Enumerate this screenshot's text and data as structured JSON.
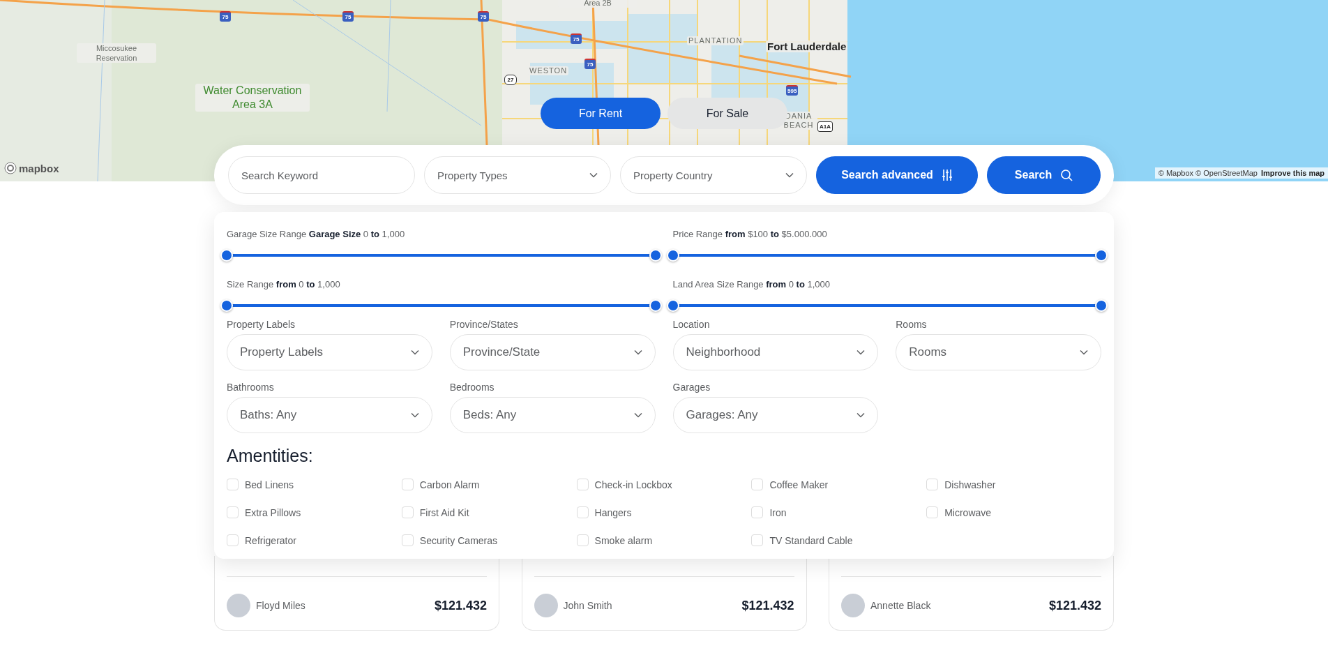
{
  "map": {
    "places": [
      {
        "kind": "small",
        "text": "Miccosukee Reservation"
      },
      {
        "kind": "park",
        "text": "Water Conservation Area 3A"
      },
      {
        "kind": "small",
        "text": "Area 2B"
      },
      {
        "kind": "district",
        "text": "PLANTATION"
      },
      {
        "kind": "city",
        "text": "Fort Lauderdale"
      },
      {
        "kind": "district",
        "text": "WESTON"
      },
      {
        "kind": "district",
        "text": "DANIA BEACH"
      }
    ],
    "shields": [
      {
        "kind": "interstate",
        "text": "75"
      },
      {
        "kind": "interstate",
        "text": "75"
      },
      {
        "kind": "interstate",
        "text": "75"
      },
      {
        "kind": "interstate",
        "text": "75"
      },
      {
        "kind": "interstate",
        "text": "75"
      },
      {
        "kind": "us",
        "text": "27"
      },
      {
        "kind": "interstate",
        "text": "595"
      },
      {
        "kind": "state",
        "text": "A1A"
      }
    ],
    "logo": "mapbox",
    "attribution": "© Mapbox © OpenStreetMap",
    "improve_link": "Improve this map"
  },
  "tabs": [
    {
      "label": "For Rent",
      "selected": true
    },
    {
      "label": "For Sale",
      "selected": false
    }
  ],
  "search": {
    "keyword_placeholder": "Search Keyword",
    "selects": [
      "Property Types",
      "Property Country"
    ],
    "advanced_button": "Search advanced",
    "search_button": "Search"
  },
  "filters": {
    "sliders": [
      {
        "label": "Garage Size Range **Garage Size** 0 **to** 1,000",
        "thumbs": [
          {
            "level": 0
          },
          {
            "level": 1
          }
        ]
      },
      {
        "label": "Price Range **from** $100 **to** $5.000.000",
        "thumbs": [
          {
            "level": 0
          },
          {
            "level": 1
          }
        ]
      },
      {
        "label": "Size Range **from** 0 **to** 1,000",
        "thumbs": [
          {
            "level": 0
          },
          {
            "level": 1
          }
        ]
      },
      {
        "label": "Land Area Size Range **from** 0 **to** 1,000",
        "thumbs": [
          {
            "level": 0
          },
          {
            "level": 1
          }
        ]
      }
    ],
    "selects": [
      {
        "label": "Property Labels",
        "value": "Property Labels"
      },
      {
        "label": "Province/States",
        "value": "Province/State"
      },
      {
        "label": "Location",
        "value": "Neighborhood"
      },
      {
        "label": "Rooms",
        "value": "Rooms"
      },
      {
        "label": "Bathrooms",
        "value": "Baths: Any"
      },
      {
        "label": "Bedrooms",
        "value": "Beds: Any"
      },
      {
        "label": "Garages",
        "value": "Garages: Any"
      }
    ],
    "amenities_title": "Amentities:",
    "amenities": [
      {
        "label": "Bed Linens",
        "checked": false
      },
      {
        "label": "Carbon Alarm",
        "checked": false
      },
      {
        "label": "Check-in Lockbox",
        "checked": false
      },
      {
        "label": "Coffee Maker",
        "checked": false
      },
      {
        "label": "Dishwasher",
        "checked": false
      },
      {
        "label": "Extra Pillows",
        "checked": false
      },
      {
        "label": "First Aid Kit",
        "checked": false
      },
      {
        "label": "Hangers",
        "checked": false
      },
      {
        "label": "Iron",
        "checked": false
      },
      {
        "label": "Microwave",
        "checked": false
      },
      {
        "label": "Refrigerator",
        "checked": false
      },
      {
        "label": "Security Cameras",
        "checked": false
      },
      {
        "label": "Smoke alarm",
        "checked": false
      },
      {
        "label": "TV Standard Cable",
        "checked": false
      }
    ]
  },
  "listings": [
    {
      "agent": "Floyd Miles",
      "price": "$121.432"
    },
    {
      "agent": "John Smith",
      "price": "$121.432"
    },
    {
      "agent": "Annette Black",
      "price": "$121.432"
    }
  ]
}
